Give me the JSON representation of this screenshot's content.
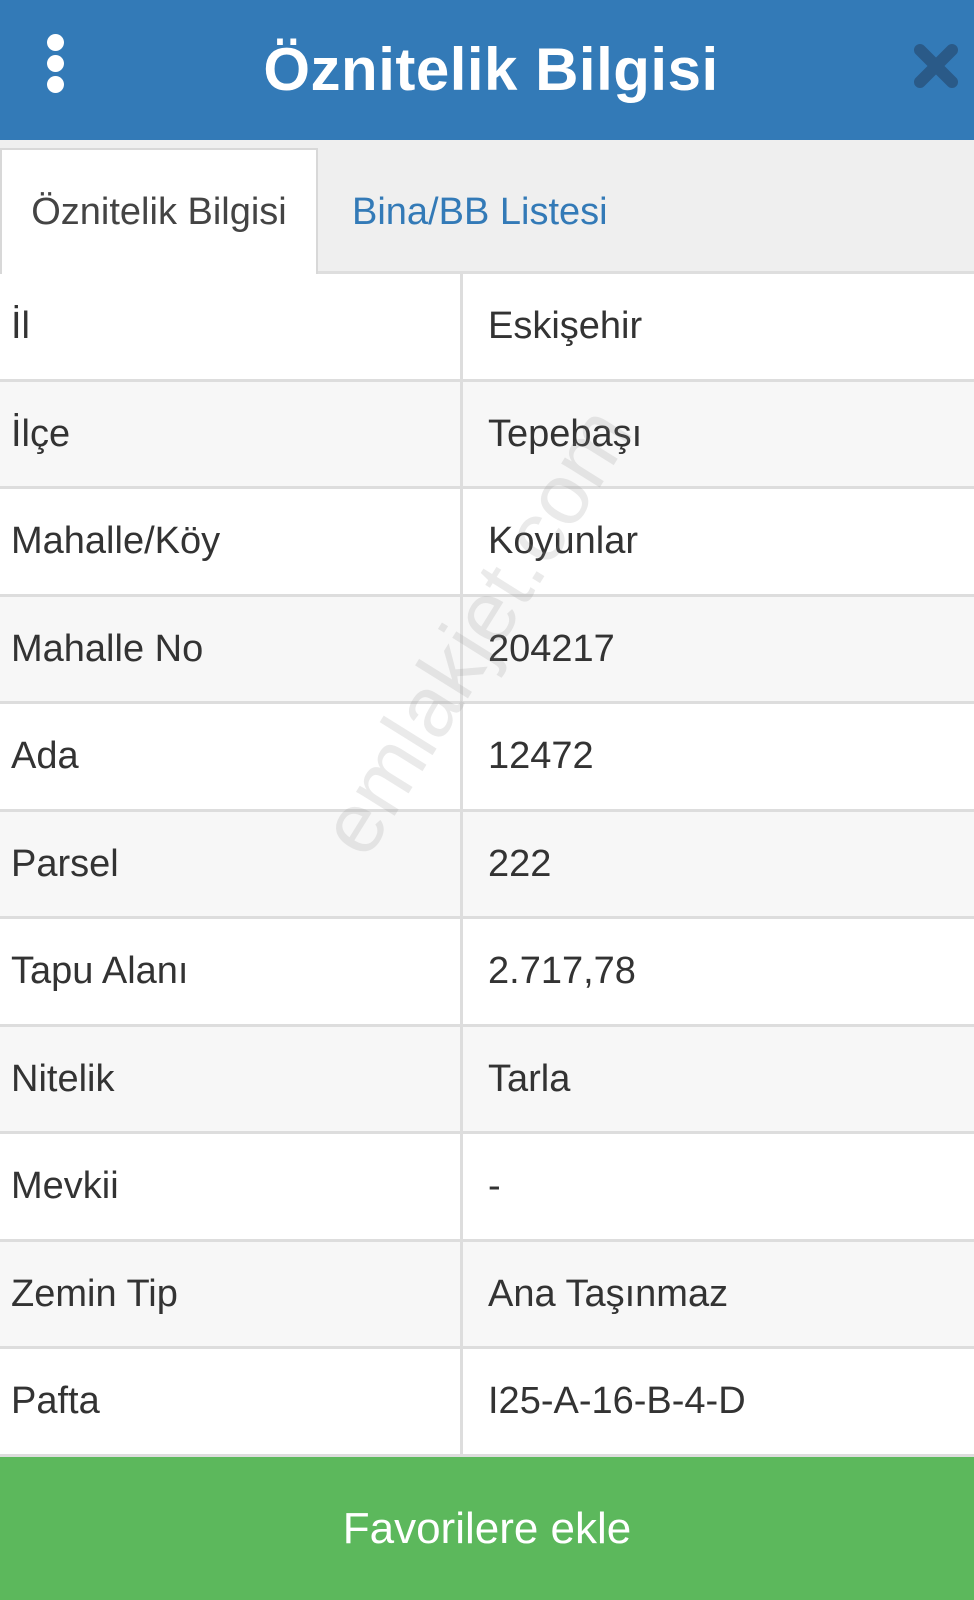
{
  "header": {
    "title": "Öznitelik Bilgisi",
    "menu_icon": "kebab-menu-icon",
    "close_icon": "close-icon",
    "background_color": "#337ab7"
  },
  "tabs": [
    {
      "label": "Öznitelik Bilgisi",
      "active": true
    },
    {
      "label": "Bina/BB Listesi",
      "active": false
    }
  ],
  "attributes": [
    {
      "label": "İl",
      "value": "Eskişehir"
    },
    {
      "label": "İlçe",
      "value": "Tepebaşı"
    },
    {
      "label": "Mahalle/Köy",
      "value": "Koyunlar"
    },
    {
      "label": "Mahalle No",
      "value": "204217"
    },
    {
      "label": "Ada",
      "value": "12472"
    },
    {
      "label": "Parsel",
      "value": "222"
    },
    {
      "label": "Tapu Alanı",
      "value": "2.717,78"
    },
    {
      "label": "Nitelik",
      "value": "Tarla"
    },
    {
      "label": "Mevkii",
      "value": "-"
    },
    {
      "label": "Zemin Tip",
      "value": "Ana Taşınmaz"
    },
    {
      "label": "Pafta",
      "value": "I25-A-16-B-4-D"
    }
  ],
  "watermark": "emlakjet.com",
  "footer": {
    "button_label": "Favorilere ekle",
    "button_color": "#5cb85c"
  }
}
